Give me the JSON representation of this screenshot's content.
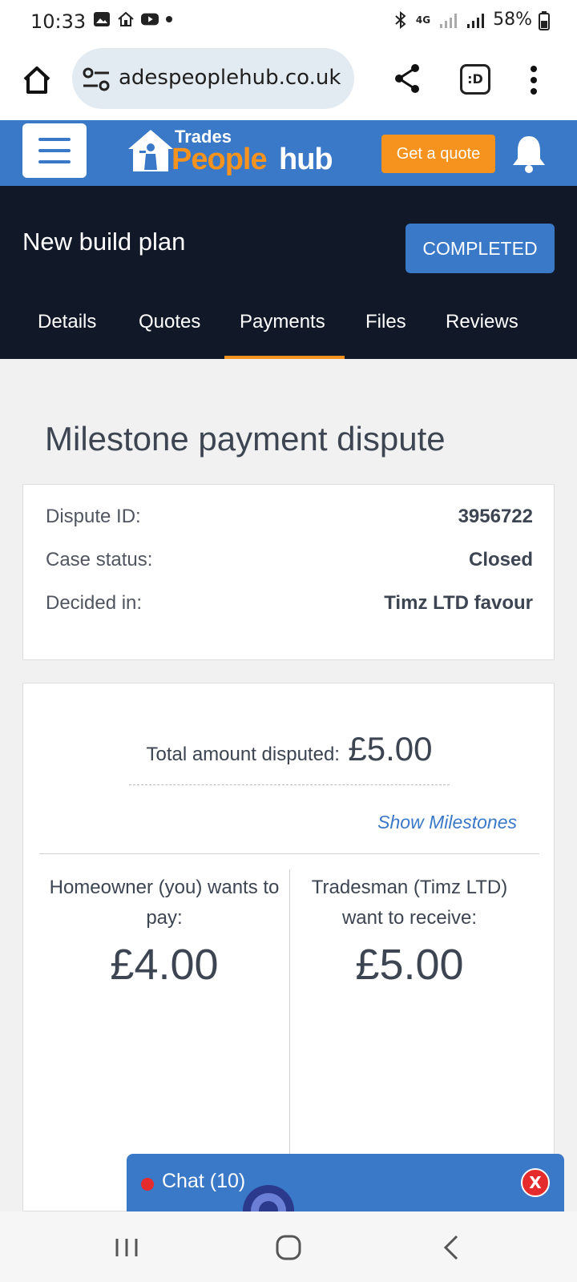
{
  "status_bar": {
    "time": "10:33",
    "network": "4G",
    "battery": "58%"
  },
  "browser": {
    "url": "adespeoplehub.co.uk",
    "tabs_label": ":D"
  },
  "site_header": {
    "logo_line1": "Trades",
    "logo_line2a": "People",
    "logo_line2b": "hub",
    "quote_button": "Get a quote",
    "brand_color": "#3a78c8",
    "accent_color": "#f6921e"
  },
  "job": {
    "title": "New build plan",
    "status": "COMPLETED",
    "tabs": [
      {
        "label": "Details"
      },
      {
        "label": "Quotes"
      },
      {
        "label": "Payments"
      },
      {
        "label": "Files"
      },
      {
        "label": "Reviews"
      }
    ],
    "active_tab": "Payments"
  },
  "page": {
    "title": "Milestone payment dispute"
  },
  "dispute": {
    "rows": [
      {
        "label": "Dispute ID:",
        "value": "3956722"
      },
      {
        "label": "Case status:",
        "value": "Closed"
      },
      {
        "label": "Decided in:",
        "value": "Timz LTD favour"
      }
    ]
  },
  "amounts": {
    "total_label": "Total amount disputed:",
    "total_value": "£5.00",
    "show_milestones": "Show Milestones",
    "homeowner_label": "Homeowner (you) wants to pay:",
    "homeowner_value": "£4.00",
    "tradesman_label": "Tradesman (Timz LTD) want to receive:",
    "tradesman_value": "£5.00"
  },
  "chat": {
    "label": "Chat (10)",
    "close": "X"
  }
}
